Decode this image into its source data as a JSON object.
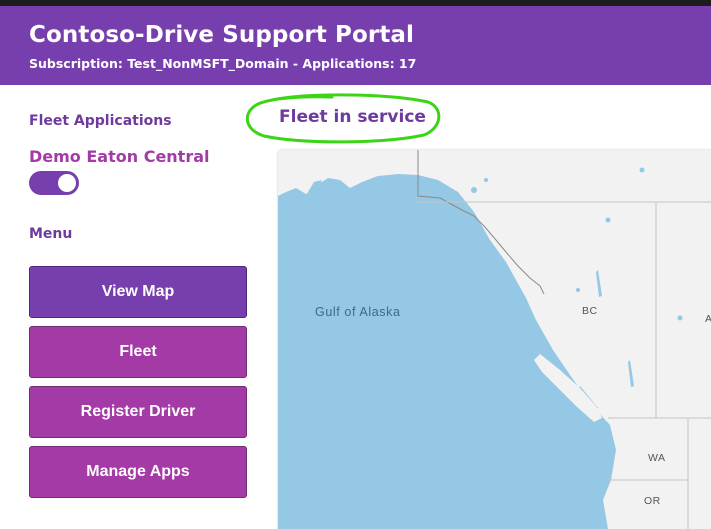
{
  "header": {
    "title": "Contoso-Drive Support Portal",
    "subtitle": "Subscription: Test_NonMSFT_Domain - Applications: 17"
  },
  "sidebar": {
    "fleet_heading": "Fleet Applications",
    "app_name": "Demo Eaton Central",
    "app_toggle_on": true,
    "menu_heading": "Menu",
    "menu_items": [
      {
        "label": "View Map",
        "active": true
      },
      {
        "label": "Fleet",
        "active": false
      },
      {
        "label": "Register Driver",
        "active": false
      },
      {
        "label": "Manage Apps",
        "active": false
      }
    ]
  },
  "main": {
    "map_title": "Fleet in service",
    "map": {
      "labels": {
        "ocean": "Gulf of Alaska",
        "bc": "BC",
        "ab": "Ab",
        "wa": "WA",
        "or": "OR"
      }
    }
  },
  "colors": {
    "header_bg": "#773fad",
    "active_button": "#773fad",
    "button": "#a43aa6",
    "accent_text": "#a23ba6",
    "annotation_circle": "#3cd417",
    "water": "#94c8e4",
    "land": "#f2f2f2"
  }
}
